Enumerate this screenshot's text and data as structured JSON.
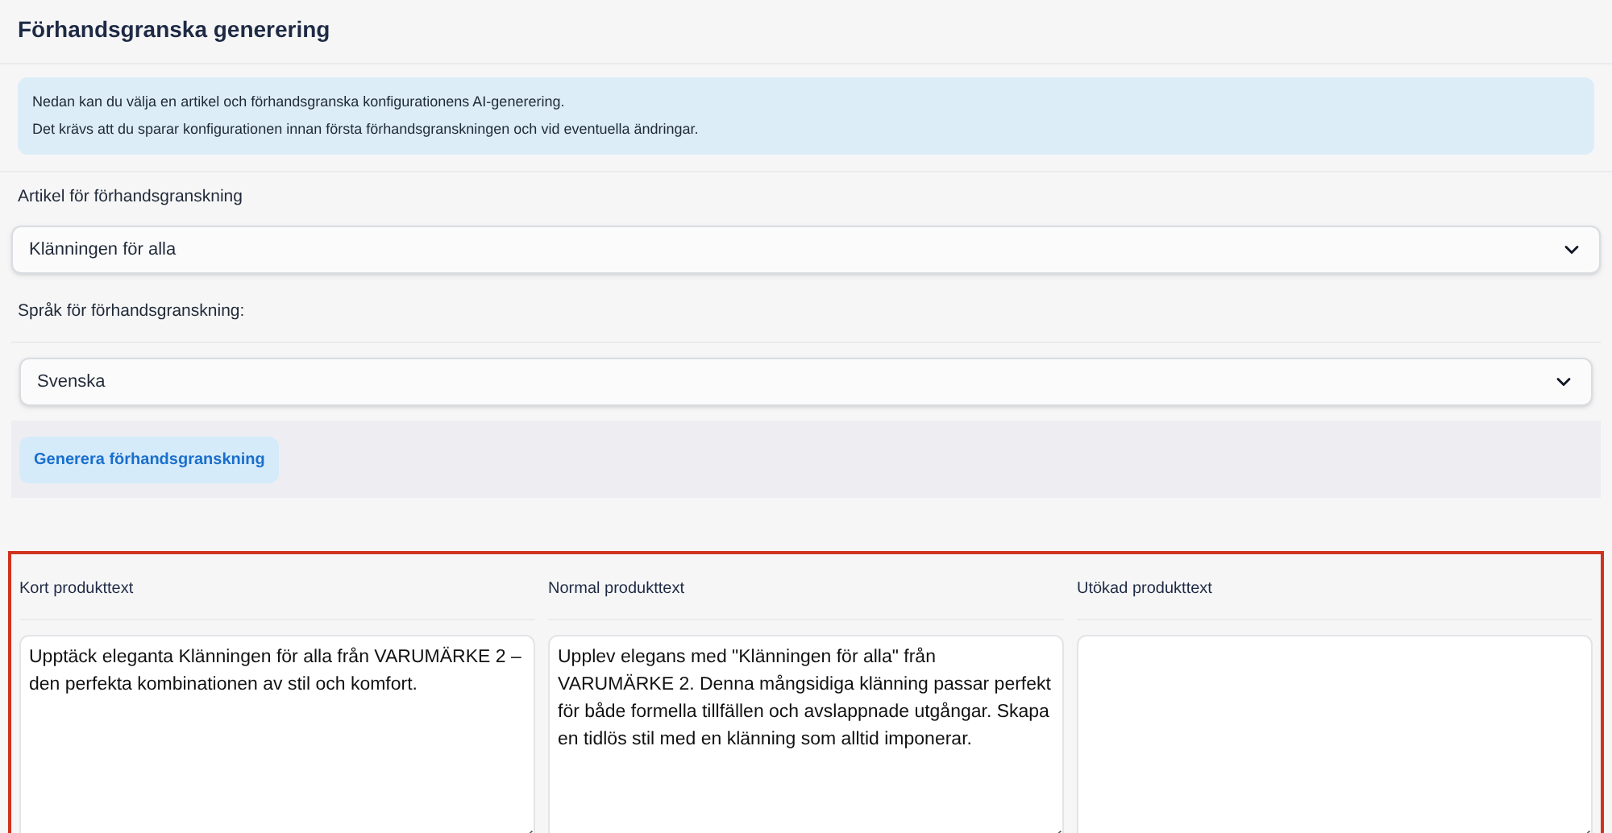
{
  "title": "Förhandsgranska generering",
  "info": [
    "Nedan kan du välja en artikel och förhandsgranska konfigurationens AI-generering.",
    "Det krävs att du sparar konfigurationen innan första förhandsgranskningen och vid eventuella ändringar."
  ],
  "article_field": {
    "label": "Artikel för förhandsgranskning",
    "value": "Klänningen för alla"
  },
  "language_field": {
    "label": "Språk för förhandsgranskning:",
    "value": "Svenska"
  },
  "generate_button": "Generera förhandsgranskning",
  "outputs": [
    {
      "label": "Kort produkttext",
      "value": "Upptäck eleganta Klänningen för alla från VARUMÄRKE 2 – den perfekta kombinationen av stil och komfort."
    },
    {
      "label": "Normal produkttext",
      "value": "Upplev elegans med \"Klänningen för alla\" från VARUMÄRKE 2. Denna mångsidiga klänning passar perfekt för både formella tillfällen och avslappnade utgångar. Skapa en tidlös stil med en klänning som alltid imponerar."
    },
    {
      "label": "Utökad produkttext"
    }
  ]
}
